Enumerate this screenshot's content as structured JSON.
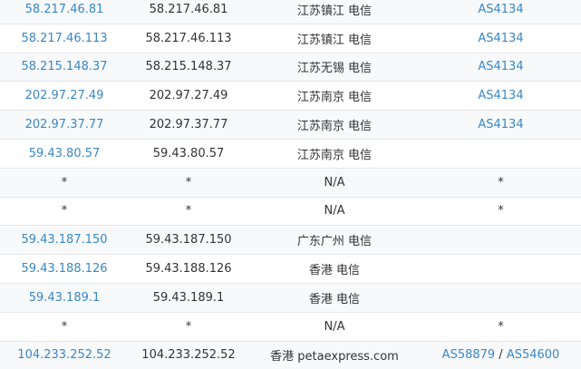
{
  "rows": [
    {
      "ip": "58.217.46.81",
      "host": "58.217.46.81",
      "location": "江苏镇江 电信",
      "asn": "AS4134"
    },
    {
      "ip": "58.217.46.113",
      "host": "58.217.46.113",
      "location": "江苏镇江 电信",
      "asn": "AS4134"
    },
    {
      "ip": "58.215.148.37",
      "host": "58.215.148.37",
      "location": "江苏无锡 电信",
      "asn": "AS4134"
    },
    {
      "ip": "202.97.27.49",
      "host": "202.97.27.49",
      "location": "江苏南京 电信",
      "asn": "AS4134"
    },
    {
      "ip": "202.97.37.77",
      "host": "202.97.37.77",
      "location": "江苏南京 电信",
      "asn": "AS4134"
    },
    {
      "ip": "59.43.80.57",
      "host": "59.43.80.57",
      "location": "江苏南京 电信",
      "asn": ""
    },
    {
      "ip": "*",
      "host": "*",
      "location": "N/A",
      "asn": "*"
    },
    {
      "ip": "*",
      "host": "*",
      "location": "N/A",
      "asn": "*"
    },
    {
      "ip": "59.43.187.150",
      "host": "59.43.187.150",
      "location": "广东广州 电信",
      "asn": ""
    },
    {
      "ip": "59.43.188.126",
      "host": "59.43.188.126",
      "location": "香港 电信",
      "asn": ""
    },
    {
      "ip": "59.43.189.1",
      "host": "59.43.189.1",
      "location": "香港 电信",
      "asn": ""
    },
    {
      "ip": "*",
      "host": "*",
      "location": "N/A",
      "asn": "*"
    },
    {
      "ip": "104.233.252.52",
      "host": "104.233.252.52",
      "location": "香港 petaexpress.com",
      "asn": "AS58879",
      "asn2": "AS54600",
      "asn_sep": " / "
    }
  ]
}
